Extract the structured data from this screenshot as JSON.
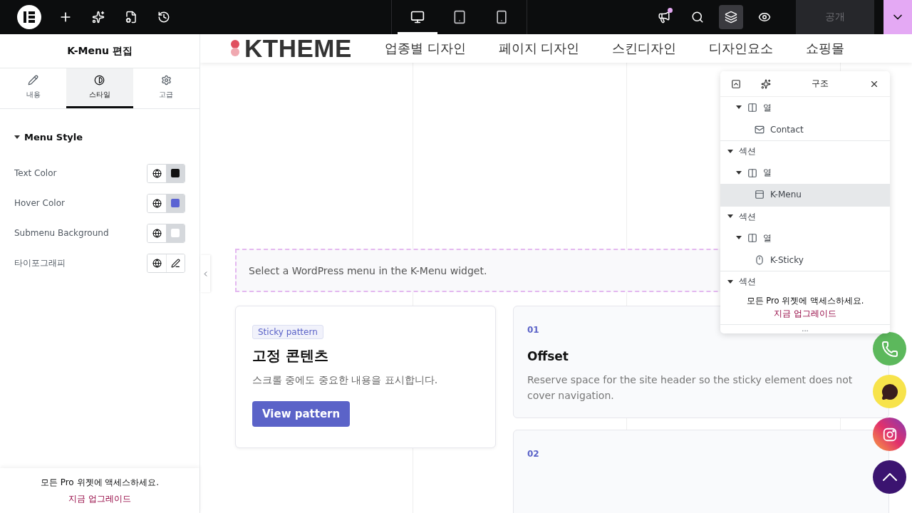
{
  "topbar": {
    "devices": [
      {
        "kind": "desktop",
        "selected": true
      },
      {
        "kind": "tablet",
        "selected": false
      },
      {
        "kind": "mobile",
        "selected": false
      }
    ],
    "notification_dot": true,
    "navigator_open": true,
    "publish": "공개"
  },
  "panel": {
    "title": "K-Menu 편집",
    "tabs": [
      {
        "kind": "content",
        "label": "내용",
        "selected": false
      },
      {
        "kind": "style",
        "label": "스타일",
        "selected": true
      },
      {
        "kind": "advanced",
        "label": "고급",
        "selected": false
      }
    ],
    "section": {
      "title": "Menu Style",
      "expanded": true
    },
    "controls": [
      {
        "kind": "color",
        "label": "Text Color",
        "color": "#111111"
      },
      {
        "kind": "color",
        "label": "Hover Color",
        "color": "#5b63d3"
      },
      {
        "kind": "color",
        "label": "Submenu Background",
        "color": "#ffffff"
      },
      {
        "kind": "typography",
        "label": "타이포그래피"
      }
    ],
    "upgrade": {
      "text": "모든 Pro 위젯에 액세스하세요.",
      "link": "지금 업그레이드"
    }
  },
  "site": {
    "logo": "KTHEME",
    "nav": [
      "업종별 디자인",
      "페이지 디자인",
      "스킨디자인",
      "디자인요소",
      "쇼핑몰"
    ],
    "menu_notice": "Select a WordPress menu in the K-Menu widget.",
    "card": {
      "tag": "Sticky pattern",
      "title": "고정 콘텐츠",
      "text": "스크롤 중에도 중요한 내용을 표시합니다.",
      "button": "View pattern"
    },
    "steps": [
      {
        "number": "01",
        "title": "Offset",
        "text": "Reserve space for the site header so the sticky element does not cover navigation."
      },
      {
        "number": "02"
      }
    ]
  },
  "navigator": {
    "title": "구조",
    "tree": [
      {
        "kind": "column",
        "label": "열",
        "expanded": true,
        "selected": false,
        "children": [
          {
            "kind": "contact",
            "label": "Contact",
            "selected": false
          }
        ]
      },
      {
        "kind": "section",
        "label": "섹션",
        "expanded": true,
        "selected": false,
        "children": [
          {
            "kind": "column",
            "label": "열",
            "expanded": true,
            "selected": false,
            "children": [
              {
                "kind": "menu",
                "label": "K-Menu",
                "selected": true
              }
            ]
          }
        ]
      },
      {
        "kind": "section",
        "label": "섹션",
        "expanded": true,
        "selected": false,
        "children": [
          {
            "kind": "column",
            "label": "열",
            "expanded": true,
            "selected": false,
            "children": [
              {
                "kind": "sticky",
                "label": "K-Sticky",
                "selected": false
              }
            ]
          }
        ]
      },
      {
        "kind": "section",
        "label": "섹션",
        "expanded": true,
        "selected": false
      }
    ],
    "upgrade": {
      "text": "모든 Pro 위젯에 액세스하세요.",
      "link": "지금 업그레이드"
    },
    "more": "..."
  }
}
